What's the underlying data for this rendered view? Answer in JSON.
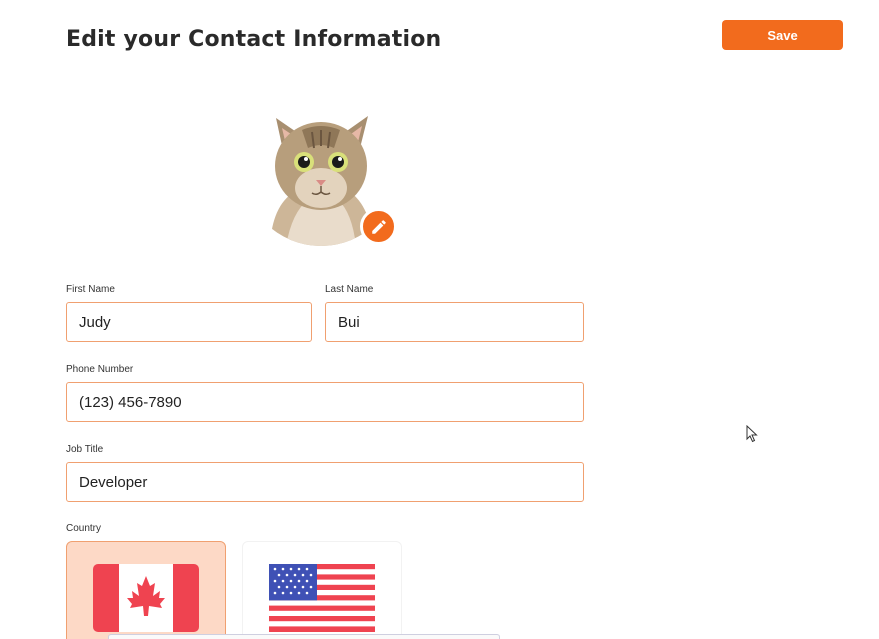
{
  "header": {
    "title": "Edit your Contact Information",
    "save_label": "Save"
  },
  "avatar": {
    "icon": "cat-photo",
    "edit_icon": "pencil-icon"
  },
  "form": {
    "first_name": {
      "label": "First Name",
      "value": "Judy"
    },
    "last_name": {
      "label": "Last Name",
      "value": "Bui"
    },
    "phone": {
      "label": "Phone Number",
      "value": "(123) 456-7890"
    },
    "job_title": {
      "label": "Job Title",
      "value": "Developer"
    },
    "country": {
      "label": "Country",
      "options": [
        {
          "name": "canada-flag",
          "selected": true
        },
        {
          "name": "usa-flag",
          "selected": false
        }
      ]
    }
  },
  "colors": {
    "accent": "#f26b1d",
    "input_border": "#f0a070",
    "selected_card": "#fdd9c6",
    "flag_red": "#ef4350",
    "flag_blue": "#3f51b5"
  }
}
